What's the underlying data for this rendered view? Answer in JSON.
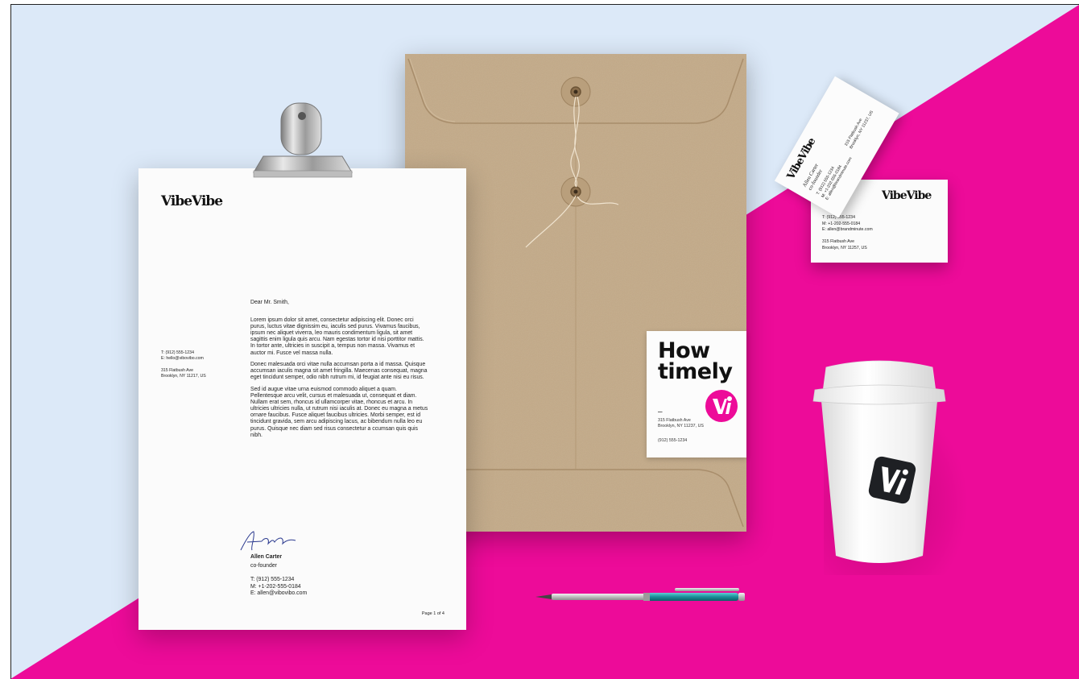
{
  "colors": {
    "pink": "#ed0b99",
    "sky": "#dce9f8",
    "kraft": "#c2a987",
    "ink": "#111111"
  },
  "brand": {
    "logo": "VibeVibe",
    "mark": "Vi"
  },
  "letter": {
    "logo": "VibeVibe",
    "contact": [
      "T: (912) 555-1234",
      "E: hello@vibovibo.com"
    ],
    "address": [
      "315 Flatbush Ave",
      "Brooklyn, NY 11217, US"
    ],
    "greeting": "Dear Mr. Smith,",
    "paragraphs": [
      "Lorem ipsum dolor sit amet, consectetur adipiscing elit. Donec orci purus, luctus vitae dignissim eu, iaculis sed purus. Vivamus faucibus, ipsum nec aliquet viverra, leo mauris condimentum ligula, sit amet sagittis enim ligula quis arcu. Nam egestas tortor id nisi porttitor mattis. In tortor ante, ultricies in suscipit a, tempus non massa. Vivamus et auctor mi. Fusce vel massa nulla.",
      "Donec malesuada orci vitae nulla accumsan porta a id massa. Quisque accumsan iaculis magna sit amet fringilla. Maecenas consequat, magna eget tincidunt semper, odio nibh rutrum mi, id feugiat ante nisi eu risus.",
      "Sed id augue vitae urna euismod commodo aliquet a quam. Pellentesque arcu velit, cursus et malesuada ut, consequat et diam. Nullam erat sem, rhoncus id ullamcorper vitae, rhoncus et arcu. In ultricies ultricies nulla, ut rutrum nisi iaculis at. Donec eu magna a metus ornare faucibus. Fusce aliquet faucibus ultricies. Morbi semper, est id tincidunt gravida, sem arcu adipiscing lacus, ac bibendum nulla leo eu purus. Quisque nec diam sed risus consectetur a ccumsan quis quis nibh."
    ],
    "signature": "Allen Carter",
    "signer_name": "Allen Carter",
    "signer_title": "co-founder",
    "signer_lines": [
      "T:  (912) 555-1234",
      "M: +1-202-555-0184",
      "E:  allen@vibovibo.com"
    ],
    "page": "Page 1 of 4"
  },
  "sticker": {
    "title_1": "How",
    "title_2": "timely",
    "dash": "–",
    "address": [
      "315 Flatbush Ave",
      "Brooklyn, NY 11237, US"
    ],
    "phone": "(912) 555-1234"
  },
  "card_back": {
    "logo": "VibeVibe",
    "co": "co",
    "lines": [
      "T:  (912) 555-1234",
      "M: +1-202-555-0184",
      "E:  allen@brandminute.com"
    ],
    "address": [
      "315 Flatbush Ave",
      "Brooklyn, NY 11257, US"
    ]
  },
  "card_front": {
    "logo": "VibeVibe",
    "name": "Allen Carter",
    "role": "co-founder",
    "lines": [
      "T: (912) 555-1234",
      "M: +1-202-555-0184",
      "E: allen@brandminute.com"
    ],
    "address": [
      "315 Flatbush Ave",
      "Brooklyn, NY 11237, US"
    ]
  },
  "cup": {
    "mark": "Vi"
  }
}
